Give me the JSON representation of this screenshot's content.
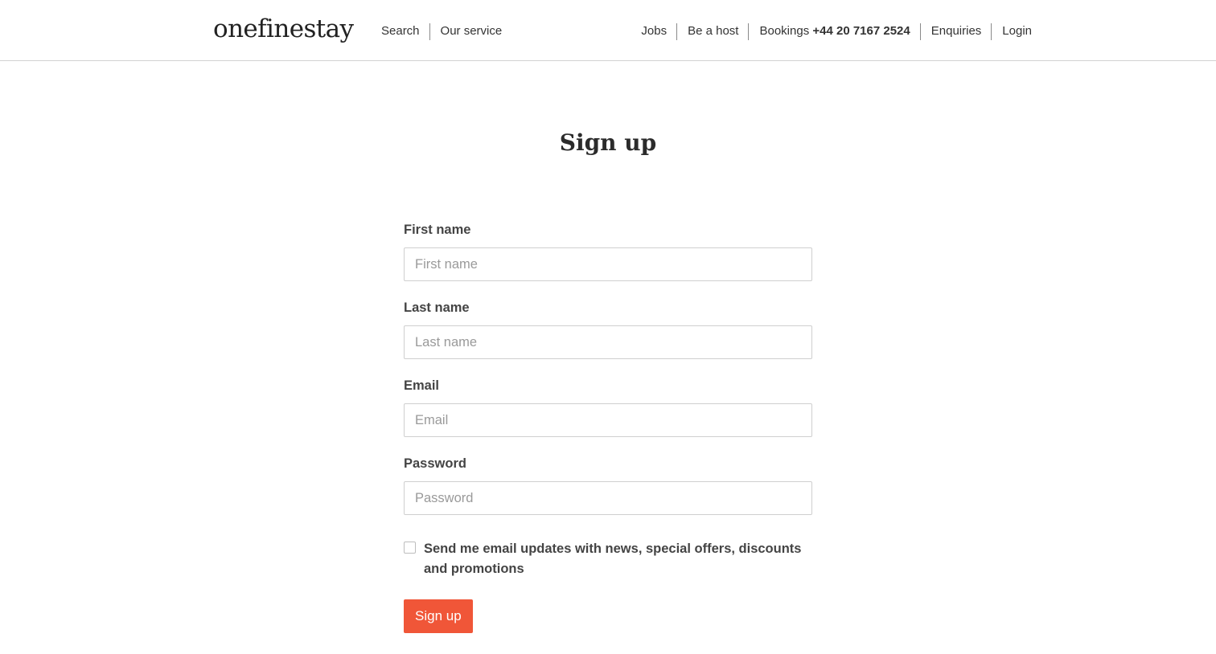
{
  "colors": {
    "accent": "#f05638",
    "text": "#333333",
    "border": "#cfcfcf",
    "placeholder": "#9a9a9a"
  },
  "header": {
    "logo": "onefinestay",
    "nav_left": [
      {
        "label": "Search"
      },
      {
        "label": "Our service"
      }
    ],
    "nav_right": {
      "jobs": "Jobs",
      "host": "Be a host",
      "bookings_label": "Bookings",
      "bookings_phone": "+44 20 7167 2524",
      "enquiries": "Enquiries",
      "login": "Login"
    }
  },
  "main": {
    "title": "Sign up",
    "fields": [
      {
        "label": "First name",
        "placeholder": "First name",
        "value": ""
      },
      {
        "label": "Last name",
        "placeholder": "Last name",
        "value": ""
      },
      {
        "label": "Email",
        "placeholder": "Email",
        "value": ""
      },
      {
        "label": "Password",
        "placeholder": "Password",
        "value": ""
      }
    ],
    "newsletter": {
      "label": "Send me email updates with news, special offers, discounts and promotions",
      "checked": false
    },
    "submit_label": "Sign up"
  }
}
